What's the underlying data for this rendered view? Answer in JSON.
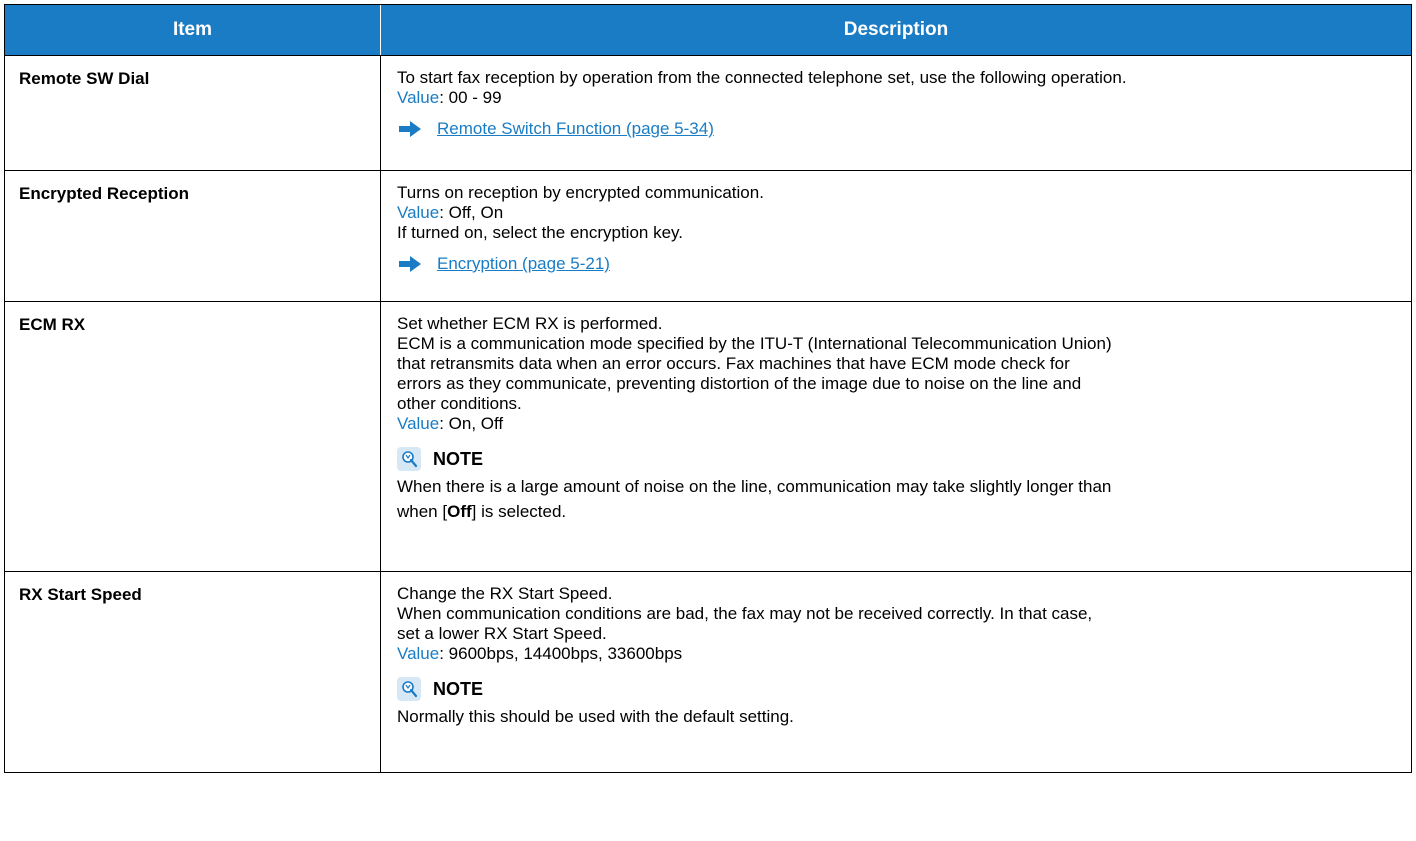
{
  "header": {
    "item": "Item",
    "description": "Description"
  },
  "rows": [
    {
      "item": "Remote SW Dial",
      "lines": [
        "To start fax reception by operation from the connected telephone set, use the following operation."
      ],
      "value_label": "Value",
      "value": ": 00 - 99",
      "link": "Remote Switch Function (page 5-34)"
    },
    {
      "item": "Encrypted Reception",
      "lines": [
        "Turns on reception by encrypted communication."
      ],
      "value_label": "Value",
      "value": ": Off, On",
      "extra": "If turned on, select the encryption key.",
      "link": "Encryption (page 5-21)"
    },
    {
      "item": "ECM RX",
      "lines": [
        "Set whether ECM RX is performed.",
        "ECM is a communication mode specified by the ITU-T (International Telecommunication Union)",
        "that retransmits data when an error occurs. Fax machines that have ECM mode check for",
        "errors as they communicate, preventing distortion of the image due to noise on the line and",
        "other conditions."
      ],
      "value_label": "Value",
      "value": ": On, Off",
      "note_title": "NOTE",
      "note_line1": "When there is a large amount of noise on the line, communication may take slightly longer than",
      "note_pre": "when [",
      "note_bold": "Off",
      "note_post": "] is selected."
    },
    {
      "item": "RX Start Speed",
      "lines": [
        "Change the RX Start Speed.",
        "When communication conditions are bad, the fax may not be received correctly. In that case,",
        "set a lower RX Start Speed."
      ],
      "value_label": "Value",
      "value": ": 9600bps, 14400bps, 33600bps",
      "note_title": "NOTE",
      "note_line1": "Normally this should be used with the default setting."
    }
  ],
  "colors": {
    "accent": "#1a7cc4",
    "header_text": "#ffffff"
  },
  "icons": {
    "link_arrow": "right-arrow-icon",
    "note": "note-lightbulb-icon"
  }
}
